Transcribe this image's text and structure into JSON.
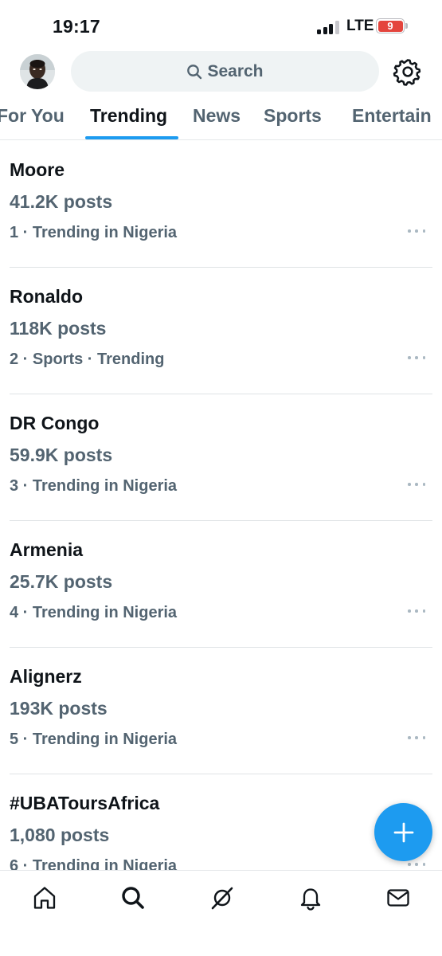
{
  "status_bar": {
    "time": "19:17",
    "network": "LTE",
    "battery_level": "9",
    "battery_color": "#e4453d"
  },
  "header": {
    "avatar_icon": "profile-avatar",
    "search_placeholder": "Search",
    "settings_icon": "gear-icon"
  },
  "tabs": [
    {
      "label": "For You",
      "active": false
    },
    {
      "label": "Trending",
      "active": true
    },
    {
      "label": "News",
      "active": false
    },
    {
      "label": "Sports",
      "active": false
    },
    {
      "label": "Entertain",
      "active": false
    }
  ],
  "trends": [
    {
      "title": "Moore",
      "count": "41.2K posts",
      "context": "1 · Trending in Nigeria"
    },
    {
      "title": "Ronaldo",
      "count": "118K posts",
      "context": "2 · Sports · Trending"
    },
    {
      "title": "DR Congo",
      "count": "59.9K posts",
      "context": "3 · Trending in Nigeria"
    },
    {
      "title": "Armenia",
      "count": "25.7K posts",
      "context": "4 · Trending in Nigeria"
    },
    {
      "title": "Alignerz",
      "count": "193K posts",
      "context": "5 · Trending in Nigeria"
    },
    {
      "title": "#UBAToursAfrica",
      "count": "1,080 posts",
      "context": "6 · Trending in Nigeria"
    }
  ],
  "fab_icon": "plus-icon",
  "bottom_nav": [
    {
      "icon": "home-icon"
    },
    {
      "icon": "search-icon",
      "active": true
    },
    {
      "icon": "grok-icon"
    },
    {
      "icon": "bell-icon"
    },
    {
      "icon": "mail-icon"
    }
  ],
  "colors": {
    "accent": "#1d9bf0",
    "text_primary": "#0f1419",
    "text_secondary": "#536471",
    "search_bg": "#eff3f4"
  }
}
